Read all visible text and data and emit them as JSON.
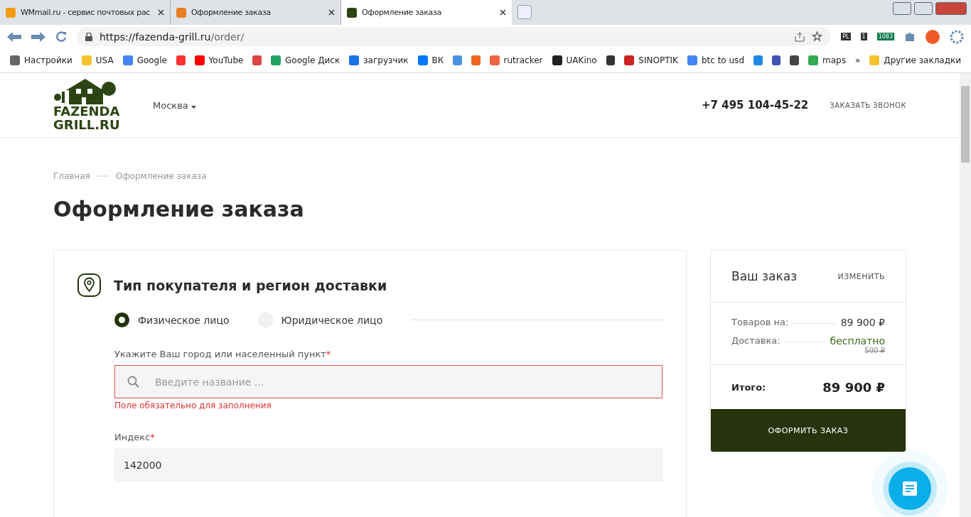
{
  "browser": {
    "tabs": [
      {
        "title": "WMmail.ru - сервис почтовых рас",
        "selected": false
      },
      {
        "title": "Оформление заказа",
        "selected": false
      },
      {
        "title": "Оформление заказа",
        "selected": true
      }
    ],
    "url": {
      "host": "https://fazenda-grill.ru",
      "path": "/order/"
    },
    "extension_badges": [
      "PL",
      "1",
      "1083"
    ],
    "bookmarks": [
      {
        "kind": "link",
        "label": "Настройки"
      },
      {
        "kind": "link",
        "label": "USA"
      },
      {
        "kind": "link",
        "label": "Google"
      },
      {
        "kind": "icon"
      },
      {
        "kind": "link",
        "label": "YouTube"
      },
      {
        "kind": "icon"
      },
      {
        "kind": "link",
        "label": "Google Диск"
      },
      {
        "kind": "link",
        "label": "загрузчик"
      },
      {
        "kind": "link",
        "label": "ВК"
      },
      {
        "kind": "icon"
      },
      {
        "kind": "icon"
      },
      {
        "kind": "link",
        "label": "rutracker"
      },
      {
        "kind": "link",
        "label": "UAKino"
      },
      {
        "kind": "icon"
      },
      {
        "kind": "link",
        "label": "SINOPTIK"
      },
      {
        "kind": "link",
        "label": "btc to usd"
      },
      {
        "kind": "icon"
      },
      {
        "kind": "icon"
      },
      {
        "kind": "icon"
      },
      {
        "kind": "link",
        "label": "maps"
      }
    ],
    "more_bookmarks": "»",
    "other_bookmarks": "Другие закладки"
  },
  "header": {
    "logo": [
      "FAZENDA",
      "GRILL.RU"
    ],
    "city": "Москва",
    "phone": "+7 495 104-45-22",
    "callback": "ЗАКАЗАТЬ ЗВОНОК"
  },
  "breadcrumbs": [
    "Главная",
    "Оформление заказа"
  ],
  "title": "Оформление заказа",
  "form": {
    "section_title": "Тип покупателя и регион доставки",
    "buyer_types": [
      {
        "label": "Физическое лицо",
        "selected": true
      },
      {
        "label": "Юридическое лицо",
        "selected": false
      }
    ],
    "city": {
      "label": "Укажите Ваш город или населенный пункт",
      "required": "*",
      "placeholder": "Введите название ...",
      "error": "Поле обязательно для заполнения"
    },
    "index": {
      "label": "Индекс",
      "required": "*",
      "value": "142000"
    }
  },
  "summary": {
    "title": "Ваш заказ",
    "edit": "ИЗМЕНИТЬ",
    "rows": [
      {
        "label": "Товаров на:",
        "value": "89 900 ₽",
        "kind": "plain"
      },
      {
        "label": "Доставка:",
        "value": "бесплатно",
        "old_value": "500 ₽",
        "kind": "free"
      }
    ],
    "total_label": "Итого:",
    "total_value": "89 900 ₽",
    "button": "ОФОРМИТЬ ЗАКАЗ"
  }
}
